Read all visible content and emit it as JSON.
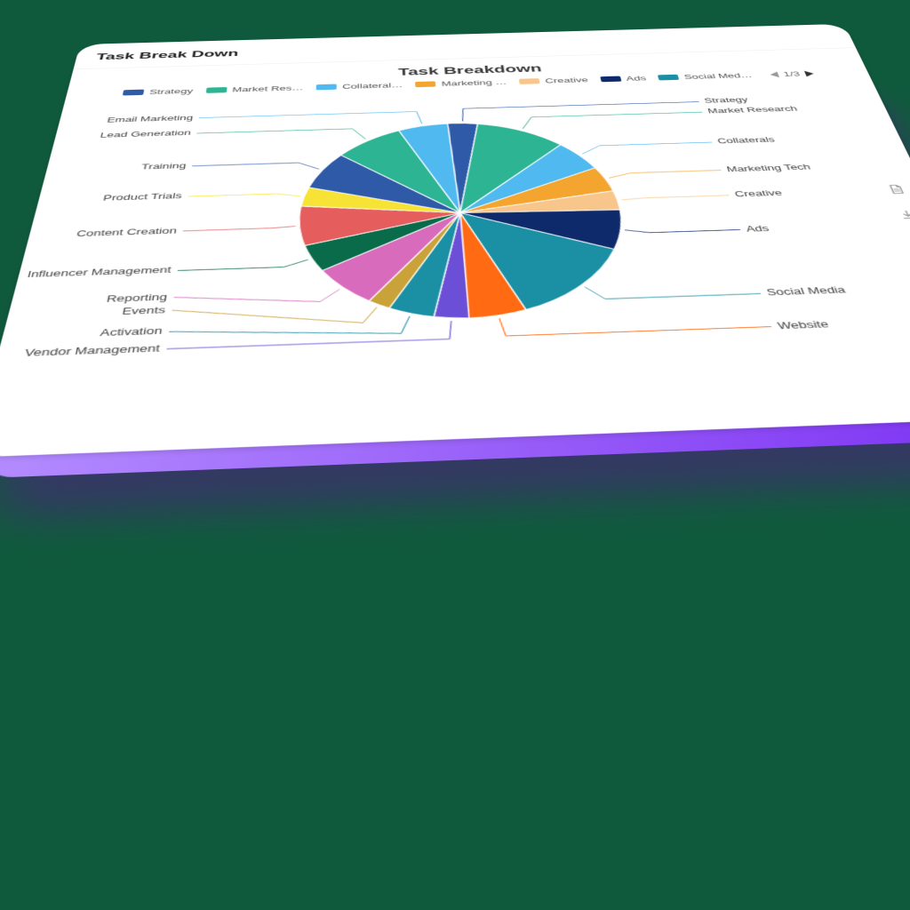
{
  "header": {
    "card_title": "Task Break Down"
  },
  "legend_page": "1/3",
  "legend_visible": [
    {
      "label": "Strategy",
      "color": "#2e5aa8"
    },
    {
      "label": "Market Res…",
      "color": "#2db493"
    },
    {
      "label": "Collateral…",
      "color": "#4fb9f0"
    },
    {
      "label": "Marketing …",
      "color": "#f3a52f"
    },
    {
      "label": "Creative",
      "color": "#f8c68b"
    },
    {
      "label": "Ads",
      "color": "#0e2a6b"
    },
    {
      "label": "Social Med…",
      "color": "#1b8fa3"
    }
  ],
  "chart_data": {
    "type": "pie",
    "title": "Task Breakdown",
    "series": [
      {
        "name": "Strategy",
        "value": 3,
        "color": "#2e5aa8"
      },
      {
        "name": "Market Research",
        "value": 9,
        "color": "#2db493"
      },
      {
        "name": "Collaterals",
        "value": 5,
        "color": "#4fb9f0"
      },
      {
        "name": "Marketing Tech",
        "value": 4,
        "color": "#f3a52f"
      },
      {
        "name": "Creative",
        "value": 3,
        "color": "#f8c68b"
      },
      {
        "name": "Ads",
        "value": 6,
        "color": "#0e2a6b"
      },
      {
        "name": "Social Media",
        "value": 12,
        "color": "#1b8fa3"
      },
      {
        "name": "Website",
        "value": 5,
        "color": "#ff6a13"
      },
      {
        "name": "Vendor Management",
        "value": 3,
        "color": "#6b4fd6"
      },
      {
        "name": "Activation",
        "value": 4,
        "color": "#1b8fa3"
      },
      {
        "name": "Events",
        "value": 2,
        "color": "#caa23a"
      },
      {
        "name": "Reporting",
        "value": 6,
        "color": "#d96bbd"
      },
      {
        "name": "Influencer Management",
        "value": 4,
        "color": "#0a6b4b"
      },
      {
        "name": "Content Creation",
        "value": 6,
        "color": "#e55d5d"
      },
      {
        "name": "Product Trials",
        "value": 3,
        "color": "#f7e335"
      },
      {
        "name": "Training",
        "value": 6,
        "color": "#2e5aa8"
      },
      {
        "name": "Lead Generation",
        "value": 7,
        "color": "#2db493"
      },
      {
        "name": "Email Marketing",
        "value": 5,
        "color": "#4fb9f0"
      }
    ]
  }
}
